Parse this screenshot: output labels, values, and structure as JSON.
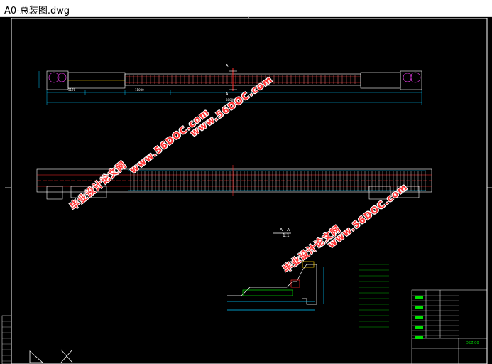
{
  "window": {
    "title": "A0-总装图.dwg"
  },
  "drawing": {
    "section_label": "A—A",
    "section_scale": "1:1",
    "dim_total": "38000",
    "dim_left": "3170",
    "dim_plain_1": "11000",
    "dim_top_A": "A",
    "dim_bot_A": "A",
    "title_block_code": "DSZ-00"
  },
  "watermarks": [
    {
      "text": "毕业设计论文网"
    },
    {
      "text": "www.56DOC.com"
    },
    {
      "text": "毕业设计论文网"
    },
    {
      "text": "www.56DOC.com"
    },
    {
      "text": "www.56DOC.com"
    }
  ],
  "colors": {
    "background": "#000000",
    "line_white": "#ffffff",
    "line_red": "#ff2a2a",
    "line_cyan": "#00c8ff",
    "line_yellow": "#ffd000",
    "line_green": "#00e000",
    "line_magenta": "#ff40ff",
    "watermark_red": "#ff3333"
  }
}
